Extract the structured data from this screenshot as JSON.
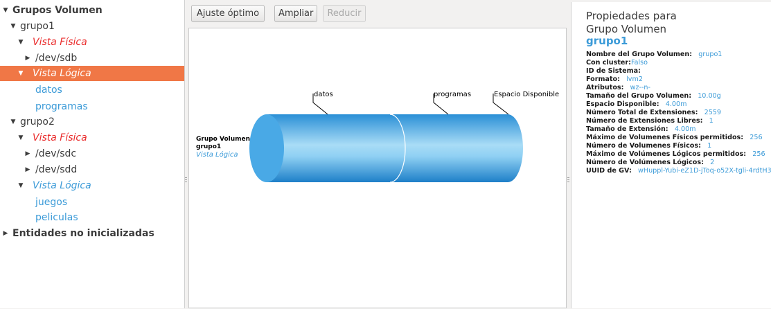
{
  "tree": {
    "root_label": "Grupos Volumen",
    "grupo1": {
      "label": "grupo1",
      "physical_label": "Vista Física",
      "pv1": "/dev/sdb",
      "logical_label": "Vista Lógica",
      "lv1": "datos",
      "lv2": "programas"
    },
    "grupo2": {
      "label": "grupo2",
      "physical_label": "Vista Física",
      "pv1": "/dev/sdc",
      "pv2": "/dev/sdd",
      "logical_label": "Vista Lógica",
      "lv1": "juegos",
      "lv2": "peliculas"
    },
    "uninit_label": "Entidades no inicializadas"
  },
  "toolbar": {
    "fit_label": "Ajuste óptimo",
    "zoom_in_label": "Ampliar",
    "zoom_out_label": "Reducir"
  },
  "diagram": {
    "vg_label": "Grupo Volumen",
    "vg_name": "grupo1",
    "view_label": "Vista Lógica",
    "segment1_label": "datos",
    "segment2_label": "programas",
    "free_label": "Espacio Disponible",
    "color_main": "#3fa8e6",
    "color_light": "#a9dcf6"
  },
  "props": {
    "title_line1": "Propiedades para",
    "title_line2": "Grupo Volumen",
    "name": "grupo1",
    "items": [
      {
        "key": "Nombre del Grupo Volumen:",
        "value": "grupo1"
      },
      {
        "key": "Con cluster:",
        "value": "Falso"
      },
      {
        "key": "ID de Sistema:",
        "value": ""
      },
      {
        "key": "Formato:",
        "value": "lvm2"
      },
      {
        "key": "Atributos:",
        "value": "wz--n-"
      },
      {
        "key": "Tamaño del Grupo Volumen:",
        "value": "10.00g"
      },
      {
        "key": "Espacio Disponible:",
        "value": "4.00m"
      },
      {
        "key": "Número Total de Extensiones:",
        "value": "2559"
      },
      {
        "key": "Número de Extensiones Libres:",
        "value": "1"
      },
      {
        "key": "Tamaño de Extensión:",
        "value": "4.00m"
      },
      {
        "key": "Máximo de Volumenes Físicos permitidos:",
        "value": "256"
      },
      {
        "key": "Número de Volumenes Físicos:",
        "value": "1"
      },
      {
        "key": "Máximo de Volúmenes Lógicos permitidos:",
        "value": "256"
      },
      {
        "key": "Número de Volúmenes Lógicos:",
        "value": "2"
      },
      {
        "key": "UUID de GV:",
        "value": "wHuppl-Yubi-eZ1D-jToq-o52X-tgli-4rdtH3"
      }
    ]
  }
}
